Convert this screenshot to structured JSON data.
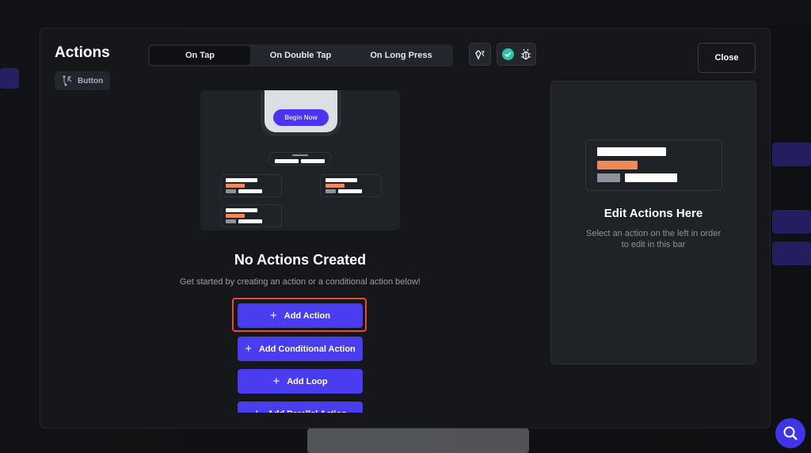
{
  "modal": {
    "title": "Actions",
    "widget_chip": "Button",
    "tabs": [
      {
        "label": "On Tap",
        "active": true
      },
      {
        "label": "On Double Tap",
        "active": false
      },
      {
        "label": "On Long Press",
        "active": false
      }
    ],
    "close_label": "Close",
    "illustration": {
      "button_label": "Begin Now"
    },
    "empty_title": "No Actions Created",
    "empty_subtitle": "Get started by creating an action or a conditional action below!",
    "buttons": [
      "Add Action",
      "Add Conditional Action",
      "Add Loop",
      "Add Parallel Action"
    ],
    "right_panel": {
      "title": "Edit Actions Here",
      "subtitle": "Select an action on the left in order to edit in this bar"
    }
  },
  "colors": {
    "accent": "#4a3df0",
    "highlight": "#e8473e",
    "check": "#2ec4a6",
    "orange": "#ee8a5a"
  }
}
